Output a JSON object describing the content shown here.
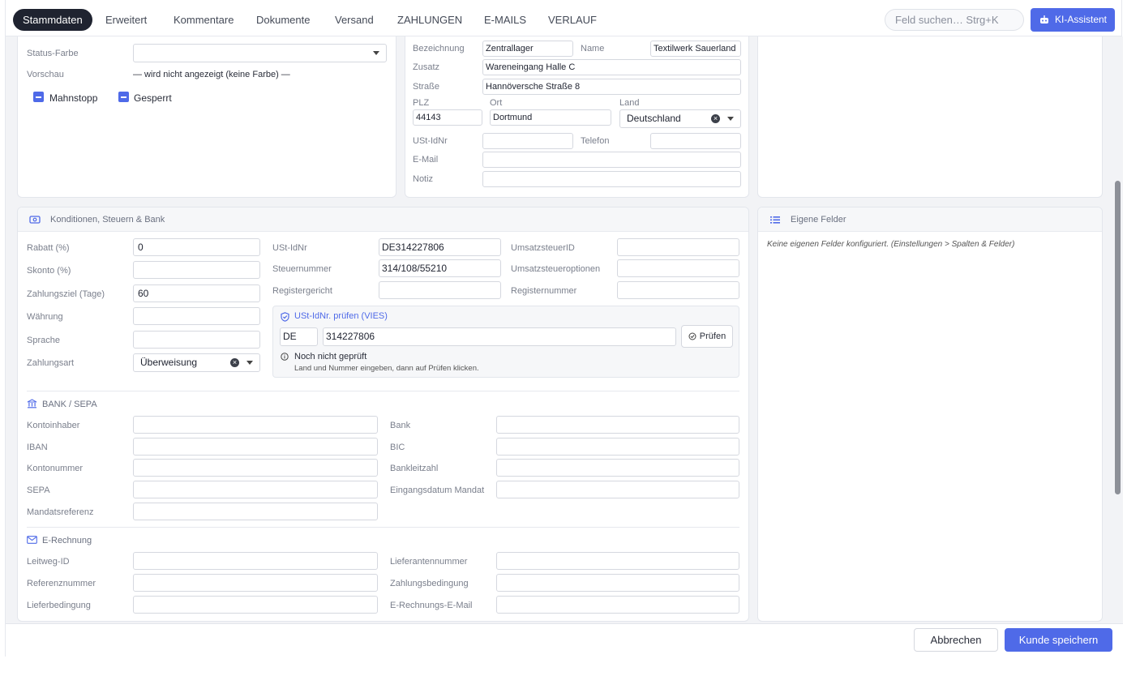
{
  "tabs": [
    "Stammdaten",
    "Erweitert",
    "Kommentare",
    "Dokumente",
    "Versand",
    "ZAHLUNGEN",
    "E-MAILS",
    "VERLAUF"
  ],
  "search": {
    "placeholder": "Feld suchen…  Strg+K"
  },
  "ki_button": "KI-Assistent",
  "status": {
    "farbe_label": "Status-Farbe",
    "vorschau_label": "Vorschau",
    "vorschau_value": "— wird nicht angezeigt (keine Farbe) —",
    "mahnstopp": "Mahnstopp",
    "gesperrt": "Gesperrt"
  },
  "address": {
    "bezeichnung_label": "Bezeichnung",
    "bezeichnung": "Zentrallager",
    "name_label": "Name",
    "name": "Textilwerk Sauerland",
    "zusatz_label": "Zusatz",
    "zusatz": "Wareneingang Halle C",
    "strasse_label": "Straße",
    "strasse": "Hannöversche Straße 8",
    "plz_label": "PLZ",
    "plz": "44143",
    "ort_label": "Ort",
    "ort": "Dortmund",
    "land_label": "Land",
    "land": "Deutschland",
    "ustid_label": "USt-IdNr",
    "telefon_label": "Telefon",
    "email_label": "E-Mail",
    "notiz_label": "Notiz"
  },
  "konditionen": {
    "title": "Konditionen, Steuern & Bank",
    "rabatt_label": "Rabatt (%)",
    "rabatt": "0",
    "skonto_label": "Skonto (%)",
    "zahlungsziel_label": "Zahlungsziel (Tage)",
    "zahlungsziel": "60",
    "waehrung_label": "Währung",
    "sprache_label": "Sprache",
    "zahlungsart_label": "Zahlungsart",
    "zahlungsart": "Überweisung",
    "ustid_label": "USt-IdNr",
    "ustid": "DE314227806",
    "steuernummer_label": "Steuernummer",
    "steuernummer": "314/108/55210",
    "registergericht_label": "Registergericht",
    "umsatzsteuerid_label": "UmsatzsteuerID",
    "umsatzsteueroptionen_label": "Umsatzsteueroptionen",
    "registernummer_label": "Registernummer"
  },
  "vies": {
    "title": "USt-IdNr. prüfen (VIES)",
    "country": "DE",
    "number": "314227806",
    "button": "Prüfen",
    "status": "Noch nicht geprüft",
    "hint": "Land und Nummer eingeben, dann auf Prüfen klicken."
  },
  "bank": {
    "title": "BANK / SEPA",
    "kontoinhaber": "Kontoinhaber",
    "bank": "Bank",
    "iban": "IBAN",
    "bic": "BIC",
    "kontonummer": "Kontonummer",
    "bankleitzahl": "Bankleitzahl",
    "sepa": "SEPA",
    "eingangsdatum": "Eingangsdatum Mandat",
    "mandatsreferenz": "Mandatsreferenz"
  },
  "erechnung": {
    "title": "E-Rechnung",
    "leitweg": "Leitweg-ID",
    "lieferantennummer": "Lieferantennummer",
    "referenznummer": "Referenznummer",
    "zahlungsbedingung": "Zahlungsbedingung",
    "lieferbedingung": "Lieferbedingung",
    "email": "E-Rechnungs-E-Mail"
  },
  "eigene": {
    "title": "Eigene Felder",
    "empty": "Keine eigenen Felder konfiguriert. (Einstellungen > Spalten & Felder)"
  },
  "footer": {
    "cancel": "Abbrechen",
    "save": "Kunde speichern"
  },
  "colors": {
    "accent": "#4f6ae8",
    "dark": "#1f2330"
  }
}
